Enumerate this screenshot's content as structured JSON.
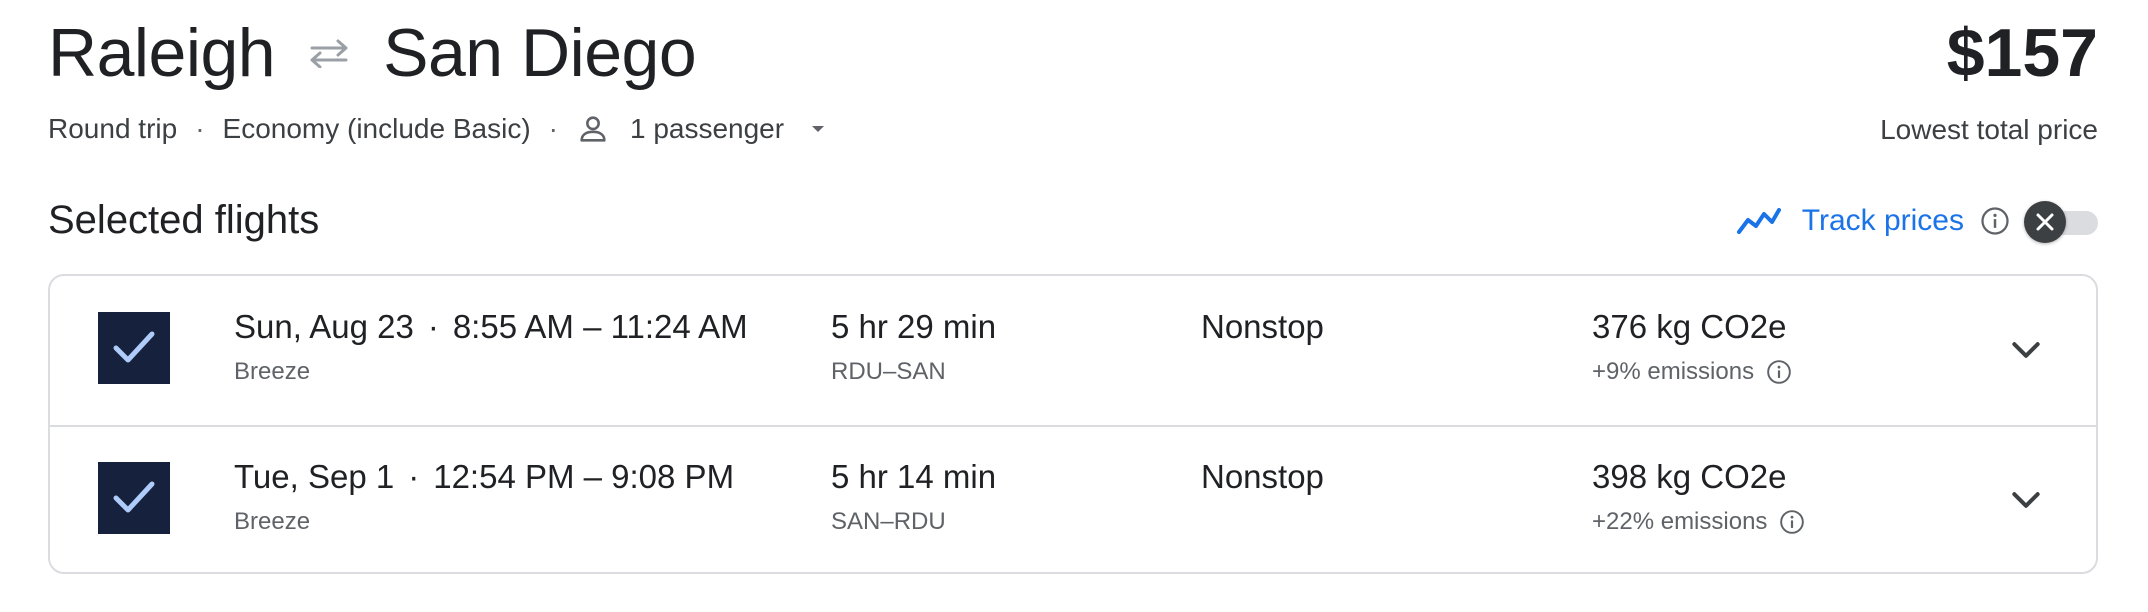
{
  "header": {
    "origin": "Raleigh",
    "destination": "San Diego",
    "swap_icon": "swap-arrows-icon",
    "price": "$157",
    "price_caption": "Lowest total price"
  },
  "options": {
    "trip_type": "Round trip",
    "cabin": "Economy (include Basic)",
    "passengers": "1 passenger",
    "separator": "·"
  },
  "selected": {
    "title": "Selected flights",
    "track_label": "Track prices",
    "track_enabled": false,
    "accent_color": "#1a73e8",
    "flights": [
      {
        "date": "Sun, Aug 23",
        "times": "8:55 AM – 11:24 AM",
        "airline": "Breeze",
        "duration": "5 hr 29 min",
        "route": "RDU–SAN",
        "stops": "Nonstop",
        "emissions": "376 kg CO2e",
        "emissions_delta": "+9% emissions"
      },
      {
        "date": "Tue, Sep 1",
        "times": "12:54 PM – 9:08 PM",
        "airline": "Breeze",
        "duration": "5 hr 14 min",
        "route": "SAN–RDU",
        "stops": "Nonstop",
        "emissions": "398 kg CO2e",
        "emissions_delta": "+22% emissions"
      }
    ]
  }
}
